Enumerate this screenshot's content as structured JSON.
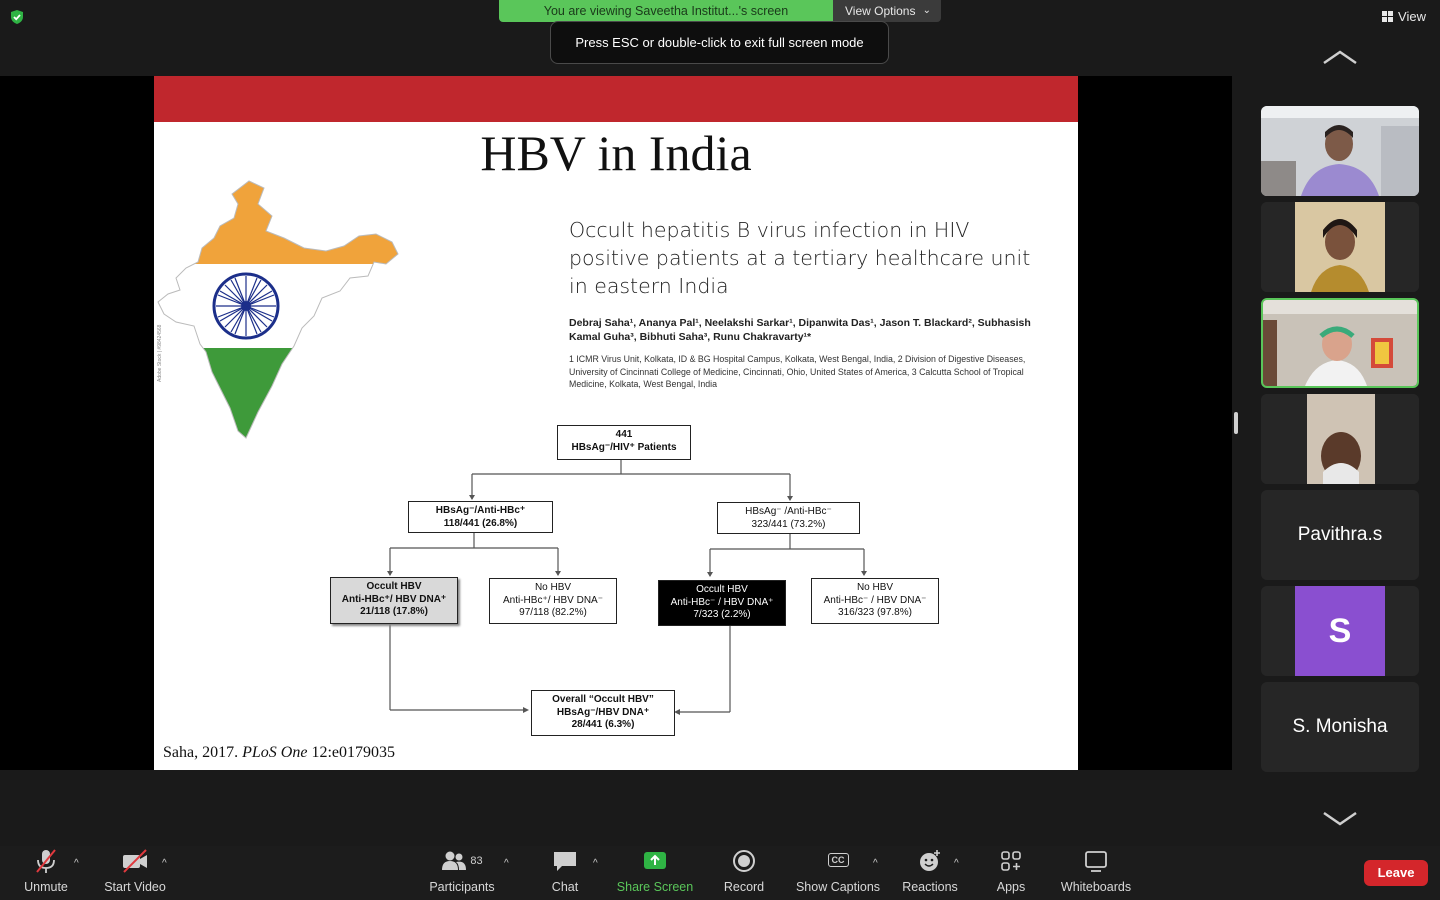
{
  "top": {
    "share_banner": "You are viewing Saveetha Institut...'s screen",
    "view_options": "View Options",
    "esc_toast": "Press ESC or double-click to exit full screen mode",
    "view_button": "View"
  },
  "slide": {
    "title": "HBV in India",
    "paper_title": "Occult hepatitis B virus infection in HIV positive patients at a tertiary healthcare unit in eastern India",
    "authors": "Debraj Saha¹, Ananya Pal¹, Neelakshi Sarkar¹, Dipanwita Das¹, Jason T. Blackard², Subhasish Kamal Guha³, Bibhuti Saha³, Runu Chakravarty¹*",
    "affiliations": "1 ICMR Virus Unit, Kolkata, ID & BG Hospital Campus, Kolkata, West Bengal, India, 2 Division of Digestive Diseases, University of Cincinnati College of Medicine, Cincinnati, Ohio, United States of America, 3 Calcutta School of Tropical Medicine, Kolkata, West Bengal, India",
    "citation_plain": "Saha, 2017.",
    "citation_journal": "PLoS One",
    "citation_ref": "12:e0179035",
    "map_watermark": "Adobe Stock | #98424568",
    "flow": {
      "root_line1": "441",
      "root_line2": "HBsAg⁻/HIV⁺ Patients",
      "left_line1": "HBsAg⁻/Anti-HBc⁺",
      "left_line2": "118/441 (26.8%)",
      "right_line1": "HBsAg⁻ /Anti-HBc⁻",
      "right_line2": "323/441 (73.2%)",
      "ll_line1": "Occult HBV",
      "ll_line2": "Anti-HBc⁺/ HBV DNA⁺",
      "ll_line3": "21/118 (17.8%)",
      "lr_line1": "No HBV",
      "lr_line2": "Anti-HBc⁺/ HBV DNA⁻",
      "lr_line3": "97/118 (82.2%)",
      "rl_line1": "Occult HBV",
      "rl_line2": "Anti-HBc⁻ / HBV DNA⁺",
      "rl_line3": "7/323 (2.2%)",
      "rr_line1": "No HBV",
      "rr_line2": "Anti-HBc⁻ / HBV DNA⁻",
      "rr_line3": "316/323 (97.8%)",
      "overall_line1": "Overall “Occult HBV”",
      "overall_line2": "HBsAg⁻/HBV DNA⁺",
      "overall_line3": "28/441 (6.3%)"
    }
  },
  "gallery": {
    "tiles": [
      {
        "type": "video"
      },
      {
        "type": "video"
      },
      {
        "type": "video",
        "active": true
      },
      {
        "type": "video"
      },
      {
        "type": "name",
        "name": "Pavithra.s"
      },
      {
        "type": "avatar",
        "initial": "S"
      },
      {
        "type": "name",
        "name": "S. Monisha"
      }
    ]
  },
  "toolbar": {
    "unmute": "Unmute",
    "start_video": "Start Video",
    "participants": "Participants",
    "participant_count": "83",
    "chat": "Chat",
    "share_screen": "Share Screen",
    "record": "Record",
    "show_captions": "Show Captions",
    "captions_badge": "CC",
    "reactions": "Reactions",
    "apps": "Apps",
    "whiteboards": "Whiteboards",
    "leave": "Leave"
  },
  "colors": {
    "share_green": "#5ac65a",
    "slide_band_red": "#c0272d",
    "leave_red": "#d4262b",
    "avatar_purple": "#8a4fd0"
  }
}
